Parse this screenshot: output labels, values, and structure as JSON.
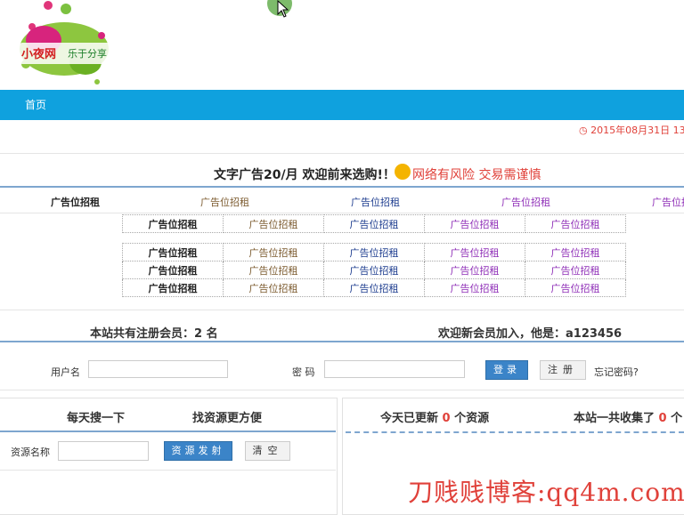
{
  "logo": {
    "main_text": "小夜网",
    "tagline": "乐于分享"
  },
  "nav": {
    "home": "首页"
  },
  "date": {
    "icon": "clock-icon",
    "text": "2015年08月31日 13"
  },
  "banner": {
    "text": "文字广告20/月 欢迎前来选购!！",
    "risk": "网络有风险 交易需谨慎"
  },
  "ad_label": "广告位招租",
  "members": {
    "count_text": "本站共有注册会员：2 名",
    "welcome_text": "欢迎新会员加入，他是：a123456"
  },
  "login": {
    "username_label": "用户名",
    "password_label": "密 码",
    "login_button": "登录",
    "register_button": "注册",
    "forgot": "忘记密码?"
  },
  "search_panel": {
    "title_left": "每天搜一下",
    "title_right": "找资源更方便",
    "field_label": "资源名称",
    "submit_button": "资源发射",
    "clear_button": "清空"
  },
  "stats_panel": {
    "updated_prefix": "今天已更新",
    "updated_count": "0",
    "updated_suffix": "个资源",
    "total_prefix": "本站一共收集了",
    "total_count": "0",
    "total_suffix": "个"
  },
  "watermark": "刀贱贱博客:qq4m.com",
  "colors": {
    "nav": "#0fa1de",
    "accent_red": "#e0413a",
    "button_blue": "#3b84c8"
  }
}
